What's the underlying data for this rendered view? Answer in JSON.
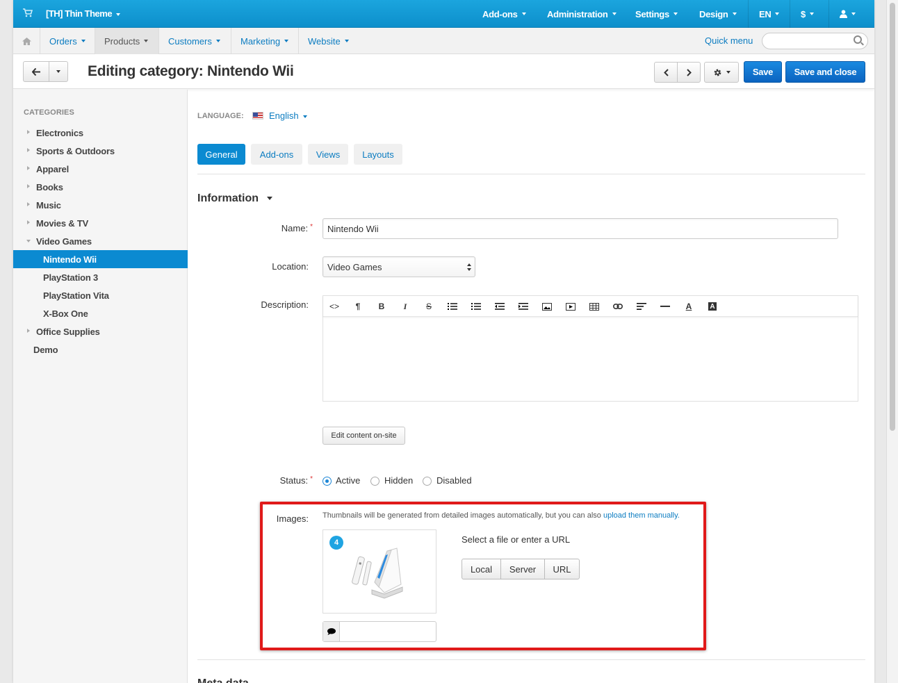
{
  "topbar": {
    "store_name": "[TH] Thin Theme",
    "items": [
      "Add-ons",
      "Administration",
      "Settings",
      "Design",
      "EN",
      "$"
    ],
    "user_icon": "user-icon",
    "cart_icon": "cart-icon"
  },
  "menubar": {
    "items": [
      "Orders",
      "Products",
      "Customers",
      "Marketing",
      "Website"
    ],
    "active": "Products",
    "quick_menu": "Quick menu",
    "search_placeholder": ""
  },
  "titlebar": {
    "title": "Editing category: Nintendo Wii",
    "save": "Save",
    "save_close": "Save and close"
  },
  "sidebar": {
    "title": "CATEGORIES",
    "items": [
      {
        "label": "Electronics",
        "expandable": true
      },
      {
        "label": "Sports & Outdoors",
        "expandable": true
      },
      {
        "label": "Apparel",
        "expandable": true
      },
      {
        "label": "Books",
        "expandable": true
      },
      {
        "label": "Music",
        "expandable": true
      },
      {
        "label": "Movies & TV",
        "expandable": true
      },
      {
        "label": "Video Games",
        "expanded": true
      },
      {
        "label": "Nintendo Wii",
        "selected": true
      },
      {
        "label": "PlayStation 3"
      },
      {
        "label": "PlayStation Vita"
      },
      {
        "label": "X-Box One"
      },
      {
        "label": "Office Supplies",
        "expandable": true
      },
      {
        "label": "Demo"
      }
    ]
  },
  "main": {
    "language_label": "LANGUAGE:",
    "language": "English",
    "tabs": [
      "General",
      "Add-ons",
      "Views",
      "Layouts"
    ],
    "active_tab": "General",
    "section_title": "Information",
    "name_label": "Name:",
    "name_value": "Nintendo Wii",
    "location_label": "Location:",
    "location_value": "Video Games",
    "description_label": "Description:",
    "edit_onsite": "Edit content on-site",
    "status_label": "Status:",
    "status_options": [
      "Active",
      "Hidden",
      "Disabled"
    ],
    "status_selected": "Active",
    "images_label": "Images:",
    "images_hint": "Thumbnails will be generated from detailed images automatically, but you can also",
    "images_hint_link": "upload them manually.",
    "image_count": "4",
    "select_file": "Select a file or enter a URL",
    "file_sources": [
      "Local",
      "Server",
      "URL"
    ],
    "next_section": "Meta data"
  },
  "colors": {
    "accent": "#0b8ad1",
    "topbar": "#1ba5de",
    "highlight": "#e01a1a"
  }
}
